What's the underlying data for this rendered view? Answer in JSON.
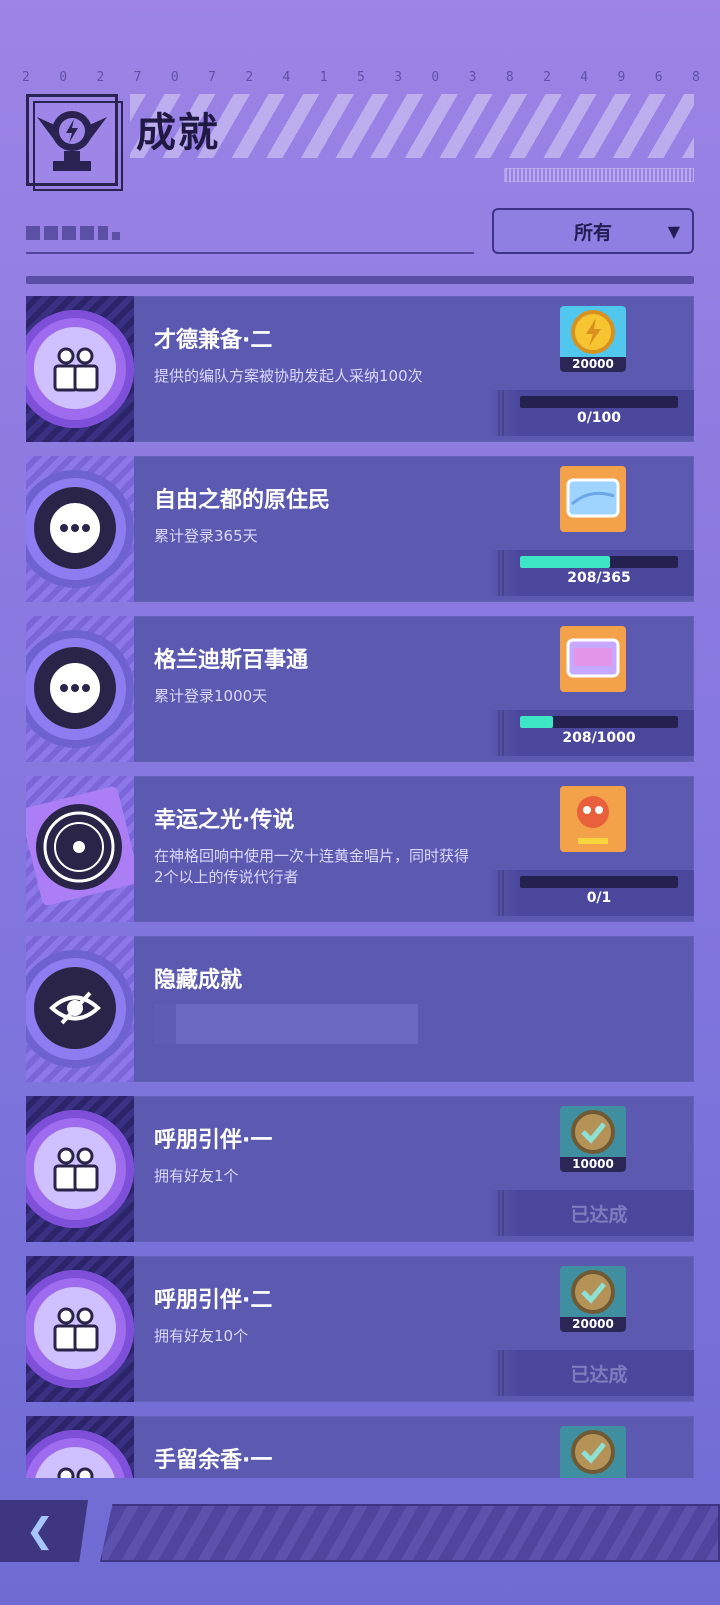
{
  "header": {
    "digits": [
      "2",
      "0",
      "2",
      "7",
      "0",
      "7",
      "2",
      "4",
      "1",
      "5",
      "3",
      "0",
      "3",
      "8",
      "2",
      "4",
      "9",
      "6",
      "8"
    ],
    "title": "成就"
  },
  "filter": {
    "selected": "所有"
  },
  "achievements": [
    {
      "title": "才德兼备·二",
      "desc": "提供的编队方案被协助发起人采纳100次",
      "reward_amount": "20000",
      "progress": "0/100",
      "progress_fraction": 0,
      "status": "in_progress",
      "badge": "friends"
    },
    {
      "title": "自由之都的原住民",
      "desc": "累计登录365天",
      "reward_amount": "",
      "progress": "208/365",
      "progress_fraction": 0.57,
      "status": "in_progress",
      "badge": "chat"
    },
    {
      "title": "格兰迪斯百事通",
      "desc": "累计登录1000天",
      "reward_amount": "",
      "progress": "208/1000",
      "progress_fraction": 0.208,
      "status": "in_progress",
      "badge": "chat"
    },
    {
      "title": "幸运之光·传说",
      "desc": "在神格回响中使用一次十连黄金唱片，同时获得2个以上的传说代行者",
      "reward_amount": "",
      "progress": "0/1",
      "progress_fraction": 0,
      "status": "in_progress",
      "badge": "record"
    },
    {
      "title": "隐藏成就",
      "desc": "",
      "reward_amount": "",
      "progress": "",
      "progress_fraction": 0,
      "status": "hidden",
      "badge": "eye"
    },
    {
      "title": "呼朋引伴·一",
      "desc": "拥有好友1个",
      "reward_amount": "10000",
      "progress": "已达成",
      "progress_fraction": 1,
      "status": "achieved",
      "badge": "friends"
    },
    {
      "title": "呼朋引伴·二",
      "desc": "拥有好友10个",
      "reward_amount": "20000",
      "progress": "已达成",
      "progress_fraction": 1,
      "status": "achieved",
      "badge": "friends"
    },
    {
      "title": "手留余香·一",
      "desc": "",
      "reward_amount": "",
      "progress": "",
      "progress_fraction": 0,
      "status": "partial",
      "badge": "friends"
    }
  ],
  "colors": {
    "accent": "#3fe6c6",
    "card": "#5c5ab0",
    "background": "#8b7ae0"
  }
}
